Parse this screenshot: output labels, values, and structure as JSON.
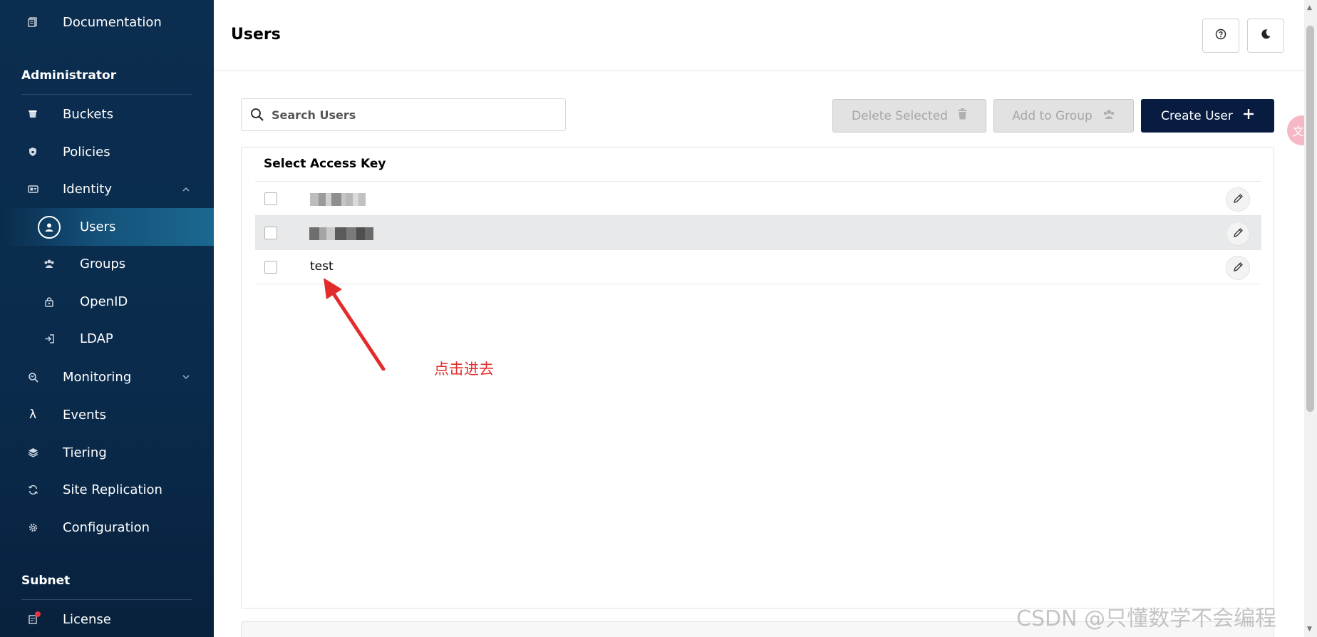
{
  "sidebar": {
    "top_item": {
      "label": "Documentation",
      "icon": "document-icon"
    },
    "administrator": {
      "title": "Administrator",
      "buckets": "Buckets",
      "policies": "Policies",
      "identity": "Identity",
      "users": "Users",
      "groups": "Groups",
      "openid": "OpenID",
      "ldap": "LDAP",
      "monitoring": "Monitoring",
      "events": "Events",
      "tiering": "Tiering",
      "site_replication": "Site Replication",
      "configuration": "Configuration"
    },
    "subnet": {
      "title": "Subnet",
      "license": "License"
    }
  },
  "header": {
    "title": "Users"
  },
  "toolbar": {
    "search_placeholder": "Search Users",
    "delete_selected": "Delete Selected",
    "add_to_group": "Add to Group",
    "create_user": "Create User"
  },
  "table": {
    "headers": [
      "Select",
      "Access Key"
    ],
    "rows": [
      {
        "access_key": "",
        "redacted": true
      },
      {
        "access_key": "",
        "redacted": true
      },
      {
        "access_key": "test",
        "redacted": false
      }
    ]
  },
  "annotation": {
    "text": "点击进去",
    "color": "#e22c2c"
  },
  "floating": {
    "translate_glyph": "文A"
  },
  "watermark": {
    "text": "CSDN @只懂数学不会编程"
  },
  "colors": {
    "sidebar_bg": "#0b2d4f",
    "primary_button": "#081c42",
    "annotation_red": "#e22c2c",
    "notification_dot": "#e4343f"
  }
}
